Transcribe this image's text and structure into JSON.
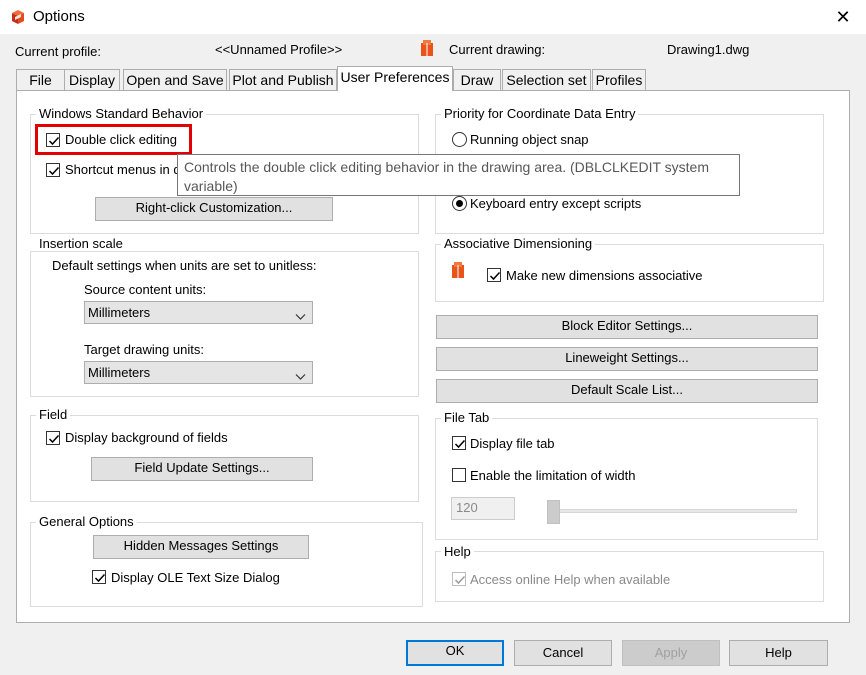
{
  "window": {
    "title": "Options"
  },
  "profile": {
    "current_profile_label": "Current profile:",
    "current_profile_value": "<<Unnamed Profile>>",
    "current_drawing_label": "Current drawing:",
    "current_drawing_value": "Drawing1.dwg"
  },
  "tabs": [
    {
      "label": "File"
    },
    {
      "label": "Display"
    },
    {
      "label": "Open and Save"
    },
    {
      "label": "Plot and Publish"
    },
    {
      "label": "User Preferences"
    },
    {
      "label": "Draw"
    },
    {
      "label": "Selection set"
    },
    {
      "label": "Profiles"
    }
  ],
  "active_tab": "User Preferences",
  "windows_behavior": {
    "title": "Windows Standard Behavior",
    "double_click_editing": "Double click editing",
    "double_click_checked": true,
    "shortcut_menus": "Shortcut menus in d",
    "shortcut_checked": true,
    "right_click_button": "Right-click Customization..."
  },
  "tooltip": {
    "text": "Controls the double click editing behavior in the drawing area. (DBLCLKEDIT system variable)"
  },
  "insertion_scale": {
    "title": "Insertion scale",
    "description": "Default settings when units are set to unitless:",
    "source_label": "Source content units:",
    "source_value": "Millimeters",
    "target_label": "Target drawing units:",
    "target_value": "Millimeters"
  },
  "field": {
    "title": "Field",
    "display_background": "Display background of fields",
    "display_background_checked": true,
    "update_button": "Field Update Settings..."
  },
  "general_options": {
    "title": "General Options",
    "hidden_messages_button": "Hidden Messages Settings",
    "display_ole": "Display OLE Text Size Dialog",
    "display_ole_checked": true
  },
  "priority": {
    "title": "Priority for Coordinate Data Entry",
    "running_snap": "Running object snap",
    "keyboard_except_scripts": "Keyboard entry except scripts",
    "selected": "Keyboard entry except scripts"
  },
  "associative": {
    "title": "Associative Dimensioning",
    "make_associative": "Make new dimensions associative",
    "make_associative_checked": true
  },
  "buttons_right": {
    "block_editor": "Block Editor Settings...",
    "lineweight": "Lineweight Settings...",
    "scale_list": "Default Scale List..."
  },
  "file_tab": {
    "title": "File Tab",
    "display_file_tab": "Display file tab",
    "display_file_tab_checked": true,
    "limit_width": "Enable the limitation of width",
    "limit_width_checked": false,
    "width_value": "120"
  },
  "help": {
    "title": "Help",
    "access_online": "Access online Help when available",
    "access_online_checked": true
  },
  "dialog_buttons": {
    "ok": "OK",
    "cancel": "Cancel",
    "apply": "Apply",
    "help": "Help"
  },
  "colors": {
    "highlight": "#e30000",
    "default_button_border": "#0078d7",
    "app_icon": "#e03c1c"
  }
}
